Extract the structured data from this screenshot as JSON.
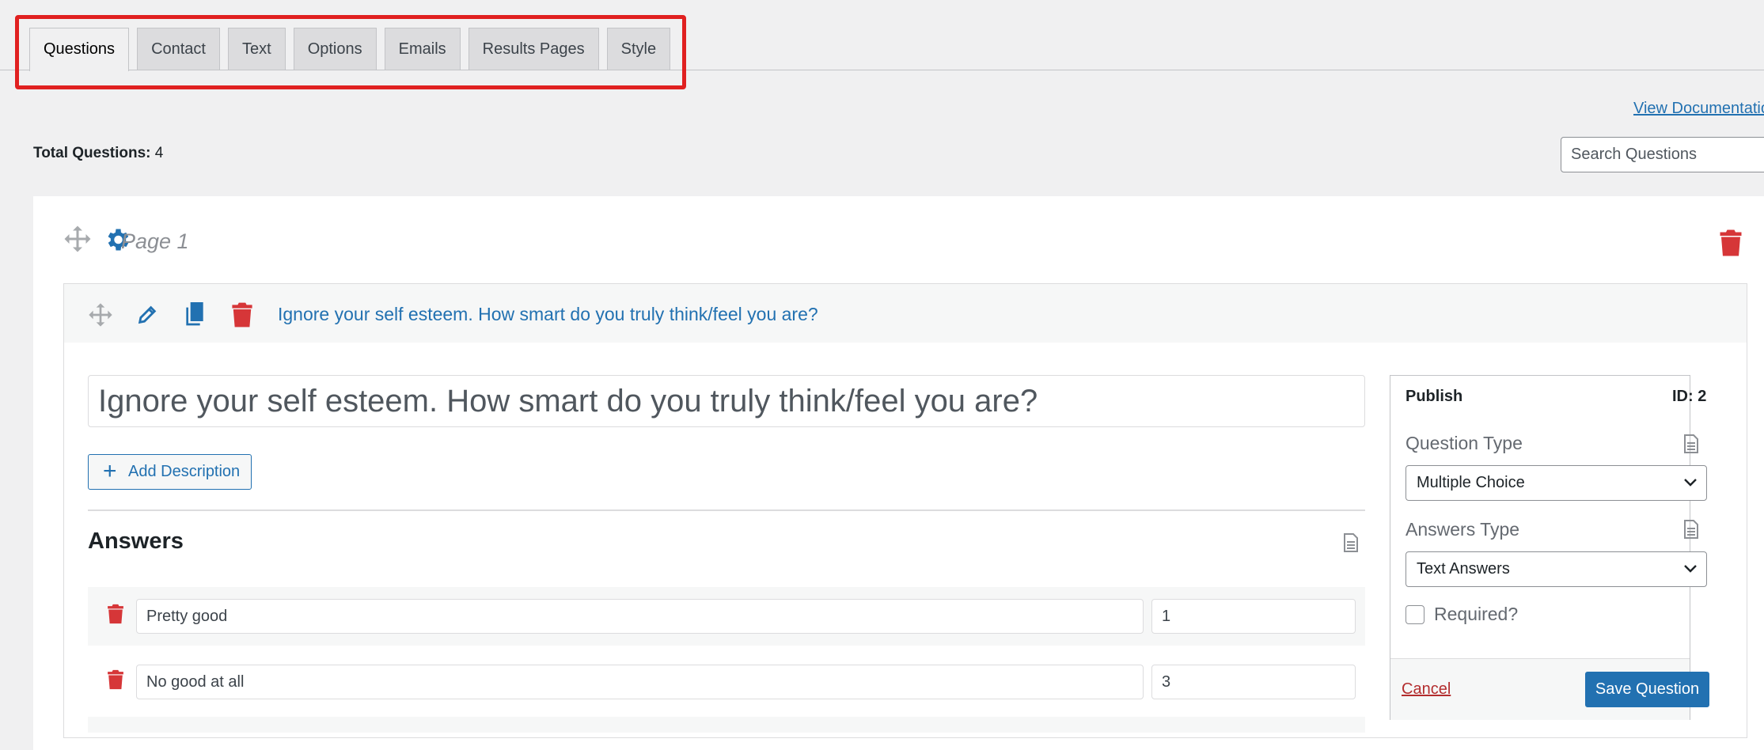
{
  "tabs": [
    {
      "label": "Questions",
      "active": true
    },
    {
      "label": "Contact"
    },
    {
      "label": "Text"
    },
    {
      "label": "Options"
    },
    {
      "label": "Emails"
    },
    {
      "label": "Results Pages"
    },
    {
      "label": "Style"
    }
  ],
  "links": {
    "documentation": "View Documentation"
  },
  "summary": {
    "total_label": "Total Questions:",
    "total_value": "4"
  },
  "search": {
    "placeholder": "Search Questions"
  },
  "page": {
    "label": "Page 1"
  },
  "question": {
    "title": "Ignore your self esteem. How smart do you truly think/feel you are?",
    "input_value": "Ignore your self esteem. How smart do you truly think/feel you are?",
    "add_description_label": "Add Description",
    "answers_heading": "Answers",
    "answers": [
      {
        "text": "Pretty good",
        "value": "1"
      },
      {
        "text": "No good at all",
        "value": "3"
      }
    ]
  },
  "publish": {
    "title": "Publish",
    "id_label": "ID: 2",
    "question_type_label": "Question Type",
    "question_type_value": "Multiple Choice",
    "answers_type_label": "Answers Type",
    "answers_type_value": "Text Answers",
    "required_label": "Required?",
    "cancel_label": "Cancel",
    "save_label": "Save Question"
  },
  "colors": {
    "accent": "#2271b1",
    "danger": "#d63638",
    "highlight": "#e02020"
  },
  "icons": [
    "move-icon",
    "gear-icon",
    "trash-icon",
    "edit-icon",
    "duplicate-icon",
    "document-icon",
    "chevron-down-icon",
    "plus-icon"
  ]
}
